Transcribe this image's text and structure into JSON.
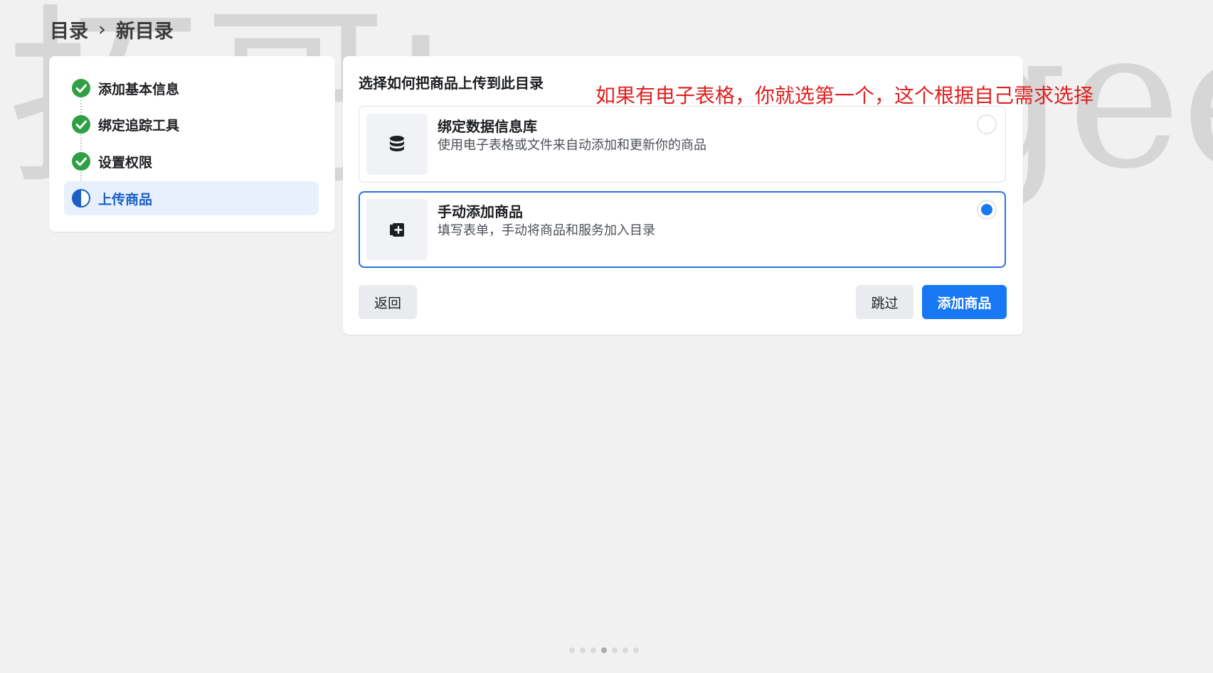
{
  "watermark": {
    "text": "拓哥tuogegee"
  },
  "breadcrumb": {
    "root": "目录",
    "separator": "›",
    "current": "新目录"
  },
  "steps": [
    {
      "label": "添加基本信息",
      "status": "done"
    },
    {
      "label": "绑定追踪工具",
      "status": "done"
    },
    {
      "label": "设置权限",
      "status": "done"
    },
    {
      "label": "上传商品",
      "status": "in-progress"
    }
  ],
  "main": {
    "title": "选择如何把商品上传到此目录",
    "annotation": "如果有电子表格，你就选第一个，这个根据自己需求选择",
    "options": [
      {
        "title": "绑定数据信息库",
        "description": "使用电子表格或文件来自动添加和更新你的商品",
        "icon": "database-icon",
        "selected": false
      },
      {
        "title": "手动添加商品",
        "description": "填写表单，手动将商品和服务加入目录",
        "icon": "add-product-icon",
        "selected": true
      }
    ],
    "buttons": {
      "back": "返回",
      "skip": "跳过",
      "add": "添加商品"
    }
  },
  "colors": {
    "primary": "#1877f2",
    "success": "#2ea043",
    "annotation": "#e02020",
    "active_step_bg": "#e7f0fc"
  },
  "pager": {
    "count": 7,
    "active_index": 3
  }
}
